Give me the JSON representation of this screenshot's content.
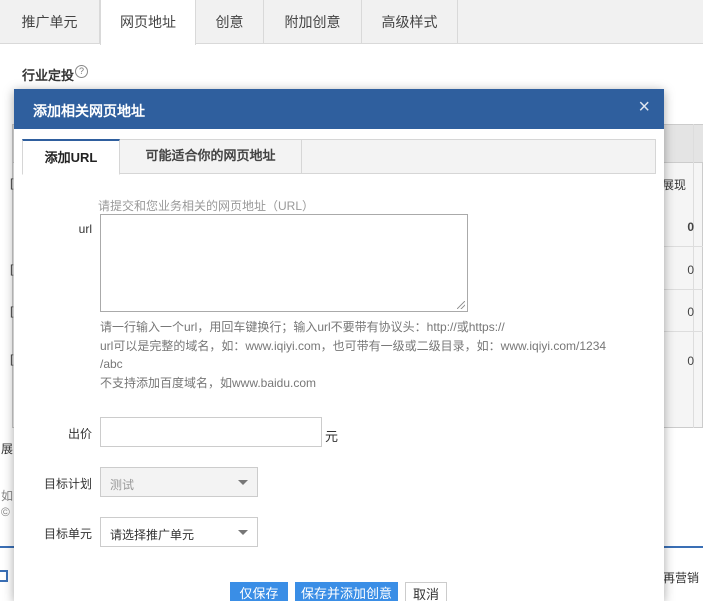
{
  "top_tabs": [
    "推广单元",
    "网页地址",
    "创意",
    "附加创意",
    "高级样式"
  ],
  "active_top_tab": "网页地址",
  "section": {
    "title": "行业定投",
    "help": "?"
  },
  "background": {
    "column_header": "展现",
    "values": [
      "0",
      "0",
      "0",
      "0"
    ],
    "left_marks": [
      "[",
      "[",
      "[",
      "["
    ],
    "side_text": [
      "展",
      "如",
      "©"
    ],
    "remarket": "再营销"
  },
  "modal": {
    "title": "添加相关网页地址",
    "close": "×",
    "tabs": [
      "添加URL",
      "可能适合你的网页地址"
    ],
    "active_tab": "添加URL",
    "url_hint": "请提交和您业务相关的网页地址（URL）",
    "url_label": "url",
    "url_value": "",
    "help_lines": [
      "请一行输入一个url，用回车键换行；输入url不要带有协议头：http://或https://",
      "url可以是完整的域名，如：www.iqiyi.com，也可带有一级或二级目录，如：www.iqiyi.com/1234",
      "/abc",
      "不支持添加百度域名，如www.baidu.com"
    ],
    "price_label": "出价",
    "price_value": "",
    "price_unit": "元",
    "plan_label": "目标计划",
    "plan_value": "测试",
    "unit_label": "目标单元",
    "unit_value": "请选择推广单元",
    "buttons": {
      "save": "仅保存",
      "save_add": "保存并添加创意",
      "cancel": "取消"
    }
  }
}
